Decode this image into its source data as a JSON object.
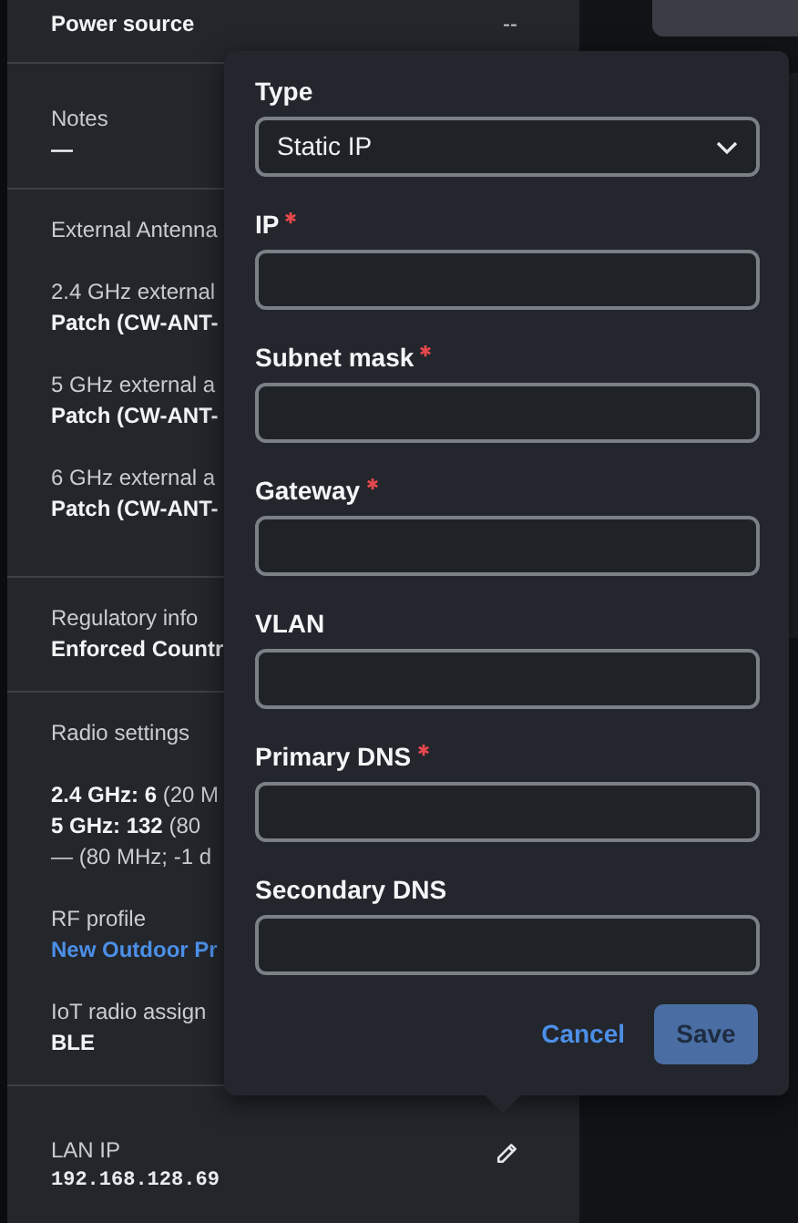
{
  "details": [
    {
      "items": [
        {
          "kind": "inline",
          "label": "Power source",
          "value": "--"
        }
      ]
    },
    {
      "items": [
        {
          "kind": "field",
          "label": "Notes",
          "value": "—"
        }
      ]
    },
    {
      "items": [
        {
          "kind": "heading",
          "label": "External Antenna"
        },
        {
          "kind": "field",
          "label": "2.4 GHz external",
          "value": "Patch (CW-ANT-"
        },
        {
          "kind": "field",
          "label": "5 GHz external a",
          "value": "Patch (CW-ANT-"
        },
        {
          "kind": "field",
          "label": "6 GHz external a",
          "value": "Patch (CW-ANT-"
        }
      ]
    },
    {
      "items": [
        {
          "kind": "field",
          "label": "Regulatory info",
          "value": "Enforced Countr"
        }
      ]
    },
    {
      "items": [
        {
          "kind": "heading",
          "label": "Radio settings"
        },
        {
          "kind": "lines",
          "lines": [
            "**2.4 GHz: 6** (20 M",
            "**5 GHz: 132** (80",
            "— (80 MHz; -1 d"
          ]
        },
        {
          "kind": "link",
          "label": "RF profile",
          "value": "New Outdoor Pr"
        },
        {
          "kind": "field",
          "label": "IoT radio assign",
          "value": "BLE"
        }
      ]
    },
    {
      "items": [
        {
          "kind": "mono",
          "label": "LAN IP",
          "value": "192.168.128.69",
          "editable": true
        }
      ]
    }
  ],
  "popover": {
    "fields": [
      {
        "kind": "select",
        "label": "Type",
        "required": false,
        "value": "Static IP"
      },
      {
        "kind": "input",
        "label": "IP",
        "required": true
      },
      {
        "kind": "input",
        "label": "Subnet mask",
        "required": true
      },
      {
        "kind": "input",
        "label": "Gateway",
        "required": true
      },
      {
        "kind": "input",
        "label": "VLAN",
        "required": false
      },
      {
        "kind": "input",
        "label": "Primary DNS",
        "required": true
      },
      {
        "kind": "input",
        "label": "Secondary DNS",
        "required": false
      }
    ],
    "cancel": {
      "label": "Cancel"
    },
    "save": {
      "label": "Save",
      "disabled": true
    }
  }
}
